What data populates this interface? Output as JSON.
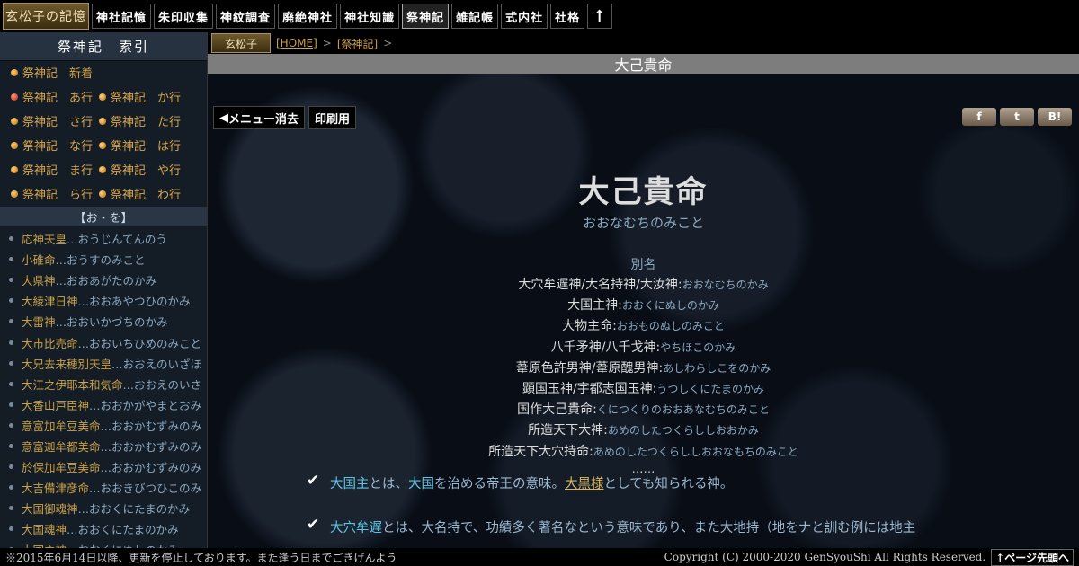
{
  "topnav": {
    "logo": "玄松子の記憶",
    "items": [
      "神社記憶",
      "朱印収集",
      "神紋調査",
      "廃絶神社",
      "神社知識",
      "祭神記",
      "雑記帳",
      "式内社",
      "社格"
    ],
    "up_icon": "↑"
  },
  "sidebar": {
    "title": "祭神記　索引",
    "index": [
      "祭神記　新着",
      "",
      "祭神記　あ行",
      "祭神記　か行",
      "祭神記　さ行",
      "祭神記　た行",
      "祭神記　な行",
      "祭神記　は行",
      "祭神記　ま行",
      "祭神記　や行",
      "祭神記　ら行",
      "祭神記　わ行"
    ],
    "sub_title": "【お・を】",
    "list": [
      {
        "name": "応神天皇",
        "reading": "…おうじんてんのう"
      },
      {
        "name": "小碓命",
        "reading": "…おうすのみこと"
      },
      {
        "name": "大県神",
        "reading": "…おおあがたのかみ"
      },
      {
        "name": "大綾津日神",
        "reading": "…おおあやつひのかみ"
      },
      {
        "name": "大雷神",
        "reading": "…おおいかづちのかみ"
      },
      {
        "name": "大市比売命",
        "reading": "…おおいちひめのみこと"
      },
      {
        "name": "大兄去来穂別天皇",
        "reading": "…おおえのいざほ"
      },
      {
        "name": "大江之伊耶本和気命",
        "reading": "…おおえのいさ"
      },
      {
        "name": "大香山戸臣神",
        "reading": "…おおかがやまとおみ"
      },
      {
        "name": "意富加牟豆美命",
        "reading": "…おおかむずみのみ"
      },
      {
        "name": "意富迦牟都美命",
        "reading": "…おおかむずみのみ"
      },
      {
        "name": "於保加牟豆美命",
        "reading": "…おおかむずみのみ"
      },
      {
        "name": "大吉備津彦命",
        "reading": "…おおきびつひこのみ"
      },
      {
        "name": "大国御魂神",
        "reading": "…おおくにたまのかみ"
      },
      {
        "name": "大国魂神",
        "reading": "…おおくにたまのかみ"
      },
      {
        "name": "大国主神",
        "reading": "…おおくにぬしのかみ"
      }
    ]
  },
  "breadcrumb": {
    "logo": "玄松子",
    "home": "[HOME]",
    "sep": ">",
    "current": "[祭神記]"
  },
  "page_title": "大己貴命",
  "toolbar": {
    "menu_hide": "メニュー消去",
    "menu_hide_icon": "◀",
    "print": "印刷用"
  },
  "social": {
    "facebook": "f",
    "twitter": "t",
    "hatena": "B!"
  },
  "deity": {
    "name": "大己貴命",
    "reading": "おおなむちのみこと",
    "alias_heading": "別名",
    "aliases": [
      {
        "name": "大穴牟遅神/大名持神/大汝神:",
        "reading": "おおなむちのかみ"
      },
      {
        "name": "大国主神:",
        "reading": "おおくにぬしのかみ"
      },
      {
        "name": "大物主命:",
        "reading": "おおものぬしのみこと"
      },
      {
        "name": "八千矛神/八千戈神:",
        "reading": "やちほこのかみ"
      },
      {
        "name": "葦原色許男神/葦原醜男神:",
        "reading": "あしわらしこをのかみ"
      },
      {
        "name": "顕国玉神/宇都志国玉神:",
        "reading": "うつしくにたまのかみ"
      },
      {
        "name": "国作大己貴命:",
        "reading": "くにつくりのおおあなむちのみこと"
      },
      {
        "name": "所造天下大神:",
        "reading": "あめのしたつくらししおおかみ"
      },
      {
        "name": "所造天下大穴持命:",
        "reading": "あめのしたつくらししおおなもちのみこと"
      }
    ],
    "ellipsis": "……"
  },
  "notes": {
    "n1_hl1": "大国主",
    "n1_t1": "とは、",
    "n1_hl2": "大国",
    "n1_t2": "を治める帝王の意味。",
    "n1_link": "大黒様",
    "n1_t3": "としても知られる神。",
    "n2_hl": "大穴牟遅",
    "n2_t": "とは、大名持で、功績多く著名なという意味であり、また大地持（地をナと訓む例には地主"
  },
  "footer": {
    "notice": "※2015年6月14日以降、更新を停止しております。また逢う日までごきげんよう",
    "copyright": "Copyright (C) 2000-2020 GenSyouShi All Rights Reserved.",
    "to_top": "↑ページ先頭へ"
  }
}
